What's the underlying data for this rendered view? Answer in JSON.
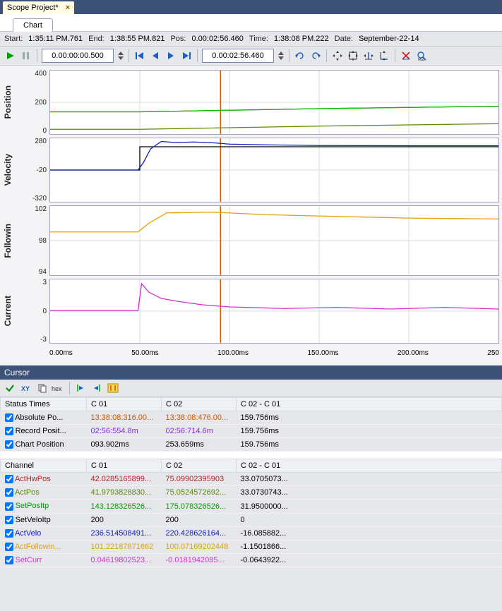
{
  "doc_tab": "Scope Project*",
  "chart_tab": "Chart",
  "info": {
    "start_lbl": "Start:",
    "start_val": "1:35:11 PM.761",
    "end_lbl": "End:",
    "end_val": "1:38:55 PM.821",
    "pos_lbl": "Pos:",
    "pos_val": "0.00:02:56.460",
    "time_lbl": "Time:",
    "time_val": "1:38:08 PM.222",
    "date_lbl": "Date:",
    "date_val": "September-22-14"
  },
  "toolbar": {
    "rec_time": "0.00:00:00.500",
    "pos_time": "0.00:02:56.460"
  },
  "panels": [
    {
      "title": "Position",
      "ticks": [
        "400",
        "200",
        "0"
      ],
      "h": 92
    },
    {
      "title": "Velocity",
      "ticks": [
        "280",
        "-20",
        "-320"
      ],
      "h": 92
    },
    {
      "title": "Followin",
      "ticks": [
        "102",
        "98",
        "94"
      ],
      "h": 100
    },
    {
      "title": "Current",
      "ticks": [
        "3",
        "0",
        "-3"
      ],
      "h": 92
    }
  ],
  "x_ticks": [
    "0.00ms",
    "50.00ms",
    "100.00ms",
    "150.00ms",
    "200.00ms",
    "250"
  ],
  "cursor_title": "Cursor",
  "status_header": [
    "Status Times",
    "C 01",
    "C 02",
    "C 02 - C 01"
  ],
  "status_rows": [
    {
      "label": "Absolute Po...",
      "c1": "13:38:08:316.00...",
      "c2": "13:38:08:476.00...",
      "d": "159.756ms",
      "color": "#cc5500"
    },
    {
      "label": "Record Posit...",
      "c1": "02:56:554.8m",
      "c2": "02:56:714.6m",
      "d": "159.756ms",
      "color": "#8a2be2"
    },
    {
      "label": "Chart Position",
      "c1": "093.902ms",
      "c2": "253.659ms",
      "d": "159.756ms",
      "color": "#000000"
    }
  ],
  "channel_header": [
    "Channel",
    "C 01",
    "C 02",
    "C 02 - C 01"
  ],
  "channel_rows": [
    {
      "label": "ActHwPos",
      "c1": "42.0285165899...",
      "c2": "75.09902395903",
      "d": "33.0705073...",
      "color": "#b22222"
    },
    {
      "label": "ActPos",
      "c1": "41.9793828830...",
      "c2": "75.0524572692...",
      "d": "33.0730743...",
      "color": "#5c8a00"
    },
    {
      "label": "SetPosItp",
      "c1": "143.128326526...",
      "c2": "175.078326526...",
      "d": "31.9500000...",
      "color": "#00a000"
    },
    {
      "label": "SetVeloItp",
      "c1": "200",
      "c2": "200",
      "d": "0",
      "color": "#000000"
    },
    {
      "label": "ActVelo",
      "c1": "236.514508491...",
      "c2": "220.428626164...",
      "d": "-16.085882...",
      "color": "#1020c0"
    },
    {
      "label": "ActFollowin...",
      "c1": "101.22187871662",
      "c2": "100.07169202448",
      "d": "-1.1501866...",
      "color": "#e0a000"
    },
    {
      "label": "SetCurr",
      "c1": "0.04619802523...",
      "c2": "-0.0181942085...",
      "d": "-0.0643922...",
      "color": "#d030d0"
    }
  ],
  "chart_data": [
    {
      "type": "line",
      "title": "Position",
      "xlabel": "ms",
      "ylim": [
        0,
        400
      ],
      "x": [
        0,
        50,
        100,
        150,
        200,
        250
      ],
      "series": [
        {
          "name": "ActHwPos",
          "color": "#b22222",
          "values": [
            140,
            140,
            150,
            160,
            168,
            175
          ]
        },
        {
          "name": "ActPos",
          "color": "#00c000",
          "values": [
            140,
            140,
            150,
            160,
            168,
            175
          ]
        },
        {
          "name": "SetPosItp",
          "color": "#5c8a00",
          "values": [
            30,
            30,
            40,
            50,
            58,
            65
          ]
        }
      ]
    },
    {
      "type": "line",
      "title": "Velocity",
      "xlabel": "ms",
      "ylim": [
        -320,
        280
      ],
      "x": [
        0,
        50,
        100,
        150,
        200,
        250
      ],
      "series": [
        {
          "name": "SetVeloItp",
          "color": "#000000",
          "values": [
            -20,
            -20,
            200,
            200,
            200,
            200
          ]
        },
        {
          "name": "ActVelo",
          "color": "#1020c0",
          "values": [
            -20,
            -20,
            230,
            215,
            210,
            210
          ]
        }
      ]
    },
    {
      "type": "line",
      "title": "Followin",
      "xlabel": "ms",
      "ylim": [
        94,
        102
      ],
      "x": [
        0,
        50,
        100,
        150,
        200,
        250
      ],
      "series": [
        {
          "name": "ActFollowin",
          "color": "#e0a000",
          "values": [
            99,
            99,
            101.2,
            101,
            100.7,
            100.5
          ]
        }
      ]
    },
    {
      "type": "line",
      "title": "Current",
      "xlabel": "ms",
      "ylim": [
        -3,
        3
      ],
      "x": [
        0,
        50,
        100,
        150,
        200,
        250
      ],
      "series": [
        {
          "name": "SetCurr",
          "color": "#d030d0",
          "values": [
            0.05,
            0.05,
            1.2,
            0.5,
            0.3,
            0.2
          ]
        }
      ]
    }
  ]
}
